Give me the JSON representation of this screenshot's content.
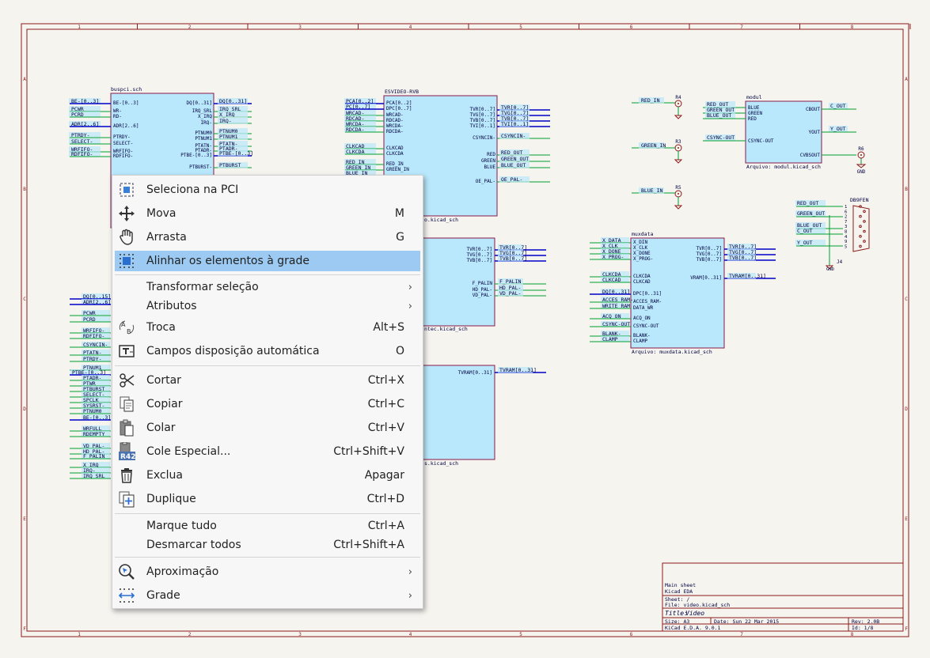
{
  "sheet": {
    "border_columns": [
      "1",
      "2",
      "3",
      "4",
      "5",
      "6",
      "7",
      "8"
    ],
    "border_rows": [
      "A",
      "B",
      "C",
      "D",
      "E",
      "F"
    ],
    "blocks": [
      {
        "id": "buspci",
        "name": "buspci.sch"
      },
      {
        "id": "esvideo",
        "name": "ESVIDEO-RVB",
        "file": "o.kicad_sch"
      },
      {
        "id": "modul",
        "name": "modul",
        "file": "Arquivo: modul.kicad_sch"
      },
      {
        "id": "muxdata",
        "name": "muxdata",
        "file": "Arquivo: muxdata.kicad_sch"
      },
      {
        "id": "graphic",
        "file": "ntec.kicad_sch"
      },
      {
        "id": "ram",
        "file": "s.kicad_sch"
      }
    ],
    "labels": {
      "buspci_left": [
        "BE-[0..3]",
        "PCWR",
        "PCRD",
        "ADR[2..6]",
        "PTRDY-",
        "SELECT-",
        "WRFIFO-",
        "RDFIFO-"
      ],
      "buspci_pins_left": [
        "BE-[0..3]",
        "WR-",
        "RD-",
        "ADR[2..6]",
        "PTRDY-",
        "SELECT-",
        "WRFIFO-",
        "RDFIFO-"
      ],
      "buspci_pins_right": [
        "DQ[0..31]",
        "IRQ_SRL",
        "X_IRQ",
        "IRQ-",
        "PTNUM0",
        "PTNUM1",
        "PTATN-",
        "PTADR-",
        "PTBE-[0..3]",
        "PTBURST-"
      ],
      "buspci_right": [
        "DQ[0..31]",
        "IRQ_SRL",
        "X_IRQ",
        "IRQ-",
        "PTNUM0",
        "PTNUM1",
        "PTATN-",
        "PTADR-",
        "PTBE-[0..3]",
        "PTBURST"
      ],
      "esvideo_left": [
        "PCA[0..2]",
        "PC[0..7]",
        "WRCAD-",
        "RDCAD-",
        "WRCDA-",
        "RDCDA-",
        "CLKCAD",
        "CLKCDA",
        "RED_IN",
        "GREEN_IN",
        "BLUE_IN"
      ],
      "esvideo_pins_left": [
        "PCA[0..2]",
        "DPC[0..7]",
        "WRCAD-",
        "RDCAD-",
        "WRCDA-",
        "RDCDA-",
        "CLKCAD",
        "CLKCDA",
        "RED_IN",
        "GREEN_IN"
      ],
      "esvideo_pins_right": [
        "TVR[0..7]",
        "TVG[0..7]",
        "TVB[0..7]",
        "TVI[0..1]",
        "CSYNCIN-",
        "RED",
        "GREEN",
        "BLUE",
        "OE_PAL-"
      ],
      "esvideo_right": [
        "TVR[0..7]",
        "TVG[0..7]",
        "TVB[0..7]",
        "TVI[0..1]",
        "CSYNCIN-",
        "RED_OUT",
        "GREEN_OUT",
        "BLUE_OUT",
        "OE_PAL-"
      ],
      "resistors": [
        "R4",
        "R3",
        "R5",
        "R6"
      ],
      "resistor_nets": [
        "RED_IN",
        "GREEN_IN",
        "BLUE_IN"
      ],
      "modul_left": [
        "RED_OUT",
        "GREEN_OUT",
        "BLUE_OUT",
        "CSYNC-OUT"
      ],
      "modul_pins_left": [
        "BLUE",
        "GREEN",
        "RED",
        "CSYNC-OUT"
      ],
      "modul_pins_right": [
        "CBOUT",
        "YOUT",
        "CVBSOUT"
      ],
      "modul_right": [
        "C_OUT",
        "Y_OUT"
      ],
      "gnd": "GND",
      "db9": {
        "ref": "DB9FEN",
        "j": "J4",
        "nets": [
          "RED_OUT",
          "GREEN_OUT",
          "BLUE_OUT",
          "C_OUT",
          "Y_OUT"
        ],
        "pins": [
          "1",
          "6",
          "2",
          "7",
          "3",
          "8",
          "4",
          "9",
          "5"
        ]
      },
      "graphic_pins_right": [
        "TVR[0..7]",
        "TVG[0..7]",
        "TVB[0..7]",
        "F_PALIN",
        "HD_PAL-",
        "VD_PAL-"
      ],
      "graphic_right": [
        "TVR[0..7]",
        "TVG[0..7]",
        "TVB[0..7]",
        "F_PALIN",
        "HD_PAL-",
        "VD_PAL-"
      ],
      "ram_pin": "TVRAM[0..31]",
      "ram_right": "TVRAM[0..31]",
      "muxdata_left": [
        "X_DATA",
        "X_CLK",
        "X_DONE",
        "X_PROG-",
        "CLKCDA",
        "CLKCAD",
        "DQ[0..31]",
        "ACCES_RAM-",
        "WRITE_RAM",
        "ACQ_ON",
        "CSYNC-OUT",
        "BLANK-",
        "CLAMP"
      ],
      "muxdata_pins_left": [
        "X_DIN",
        "X_CLK",
        "X_DONE",
        "X_PROG-",
        "CLKCDA",
        "CLKCAD",
        "DPC[0..31]",
        "ACCES_RAM-",
        "DATA_WR",
        "ACQ_ON",
        "CSYNC-OUT",
        "BLANK-",
        "CLAMP"
      ],
      "muxdata_pins_right": [
        "TVR[0..7]",
        "TVG[0..7]",
        "TVB[0..7]",
        "VRAM[0..31]"
      ],
      "muxdata_right": [
        "TVR[0..7]",
        "TVG[0..7]",
        "TVB[0..7]",
        "TVRAM[0..31]"
      ],
      "left_column": [
        "DQ[0..15]",
        "ADR[2..6]",
        "PCWR",
        "PCRD",
        "WRFIFO-",
        "RDFIFO-",
        "CSYNCIN-",
        "PTATN-",
        "PTRDY-",
        "PTNUM1",
        "PTBE-[0..3]",
        "PTADR-",
        "PTWR",
        "PTBURST",
        "SELECT-",
        "SPCLK",
        "SYSRST-",
        "PTNUM0",
        "BE-[0..3]",
        "WRFULL",
        "RDEMPTY",
        "VD_PAL-",
        "HD_PAL-",
        "F_PALIN",
        "X_IRQ",
        "IRQ-",
        "IRQ_SRL"
      ]
    },
    "title_block": {
      "sheet_name": "Main sheet",
      "company": "Kicad EDA",
      "sheet_path": "Sheet: /",
      "file": "File: video.kicad_sch",
      "title_label": "Title:",
      "title": "Video",
      "size": "Size: A3",
      "date": "Date: Sun 22 Mar 2015",
      "rev": "Rev: 2.0B",
      "software": "KiCad E.D.A. 9.0.1",
      "id": "Id: 1/8"
    }
  },
  "context_menu": {
    "items": [
      {
        "icon": "select-pcb-icon",
        "label": "Seleciona na PCI",
        "shortcut": ""
      },
      {
        "icon": "move-icon",
        "label": "Mova",
        "shortcut": "M"
      },
      {
        "icon": "drag-hand-icon",
        "label": "Arrasta",
        "shortcut": "G"
      },
      {
        "icon": "align-grid-icon",
        "label": "Alinhar os elementos à grade",
        "shortcut": "",
        "highlighted": true
      },
      {
        "icon": "",
        "label": "Transformar seleção",
        "submenu": true
      },
      {
        "icon": "",
        "label": "Atributos",
        "submenu": true
      },
      {
        "icon": "swap-icon",
        "label": "Troca",
        "shortcut": "Alt+S"
      },
      {
        "icon": "autoplace-fields-icon",
        "label": "Campos disposição automática",
        "shortcut": "O"
      },
      {
        "icon": "cut-icon",
        "label": "Cortar",
        "shortcut": "Ctrl+X"
      },
      {
        "icon": "copy-icon",
        "label": "Copiar",
        "shortcut": "Ctrl+C"
      },
      {
        "icon": "paste-icon",
        "label": "Colar",
        "shortcut": "Ctrl+V"
      },
      {
        "icon": "paste-special-icon",
        "label": "Cole Especial...",
        "shortcut": "Ctrl+Shift+V"
      },
      {
        "icon": "trash-icon",
        "label": "Exclua",
        "shortcut": "Apagar"
      },
      {
        "icon": "duplicate-icon",
        "label": "Duplique",
        "shortcut": "Ctrl+D"
      },
      {
        "icon": "",
        "label": "Marque tudo",
        "shortcut": "Ctrl+A"
      },
      {
        "icon": "",
        "label": "Desmarcar todos",
        "shortcut": "Ctrl+Shift+A"
      },
      {
        "icon": "zoom-icon",
        "label": "Aproximação",
        "submenu": true
      },
      {
        "icon": "grid-icon",
        "label": "Grade",
        "submenu": true
      }
    ],
    "paste_special_badge": "R42"
  },
  "colors": {
    "background": "#f5f4ef",
    "border": "#8b1a1a",
    "sheet_fill": "#b9e7fb",
    "sheet_outline": "#8b1a4a",
    "wire": "#00a030",
    "bus": "#0000c8",
    "label": "#000040",
    "highlight": "#9ccaf2"
  }
}
